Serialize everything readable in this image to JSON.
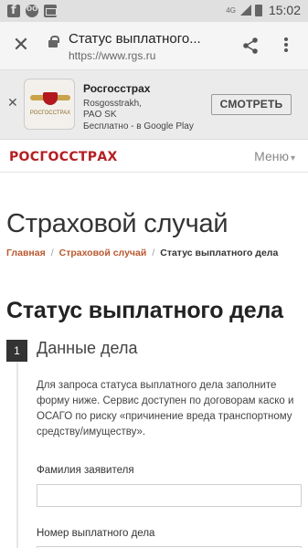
{
  "statusbar": {
    "network": "4G",
    "time": "15:02"
  },
  "browser": {
    "title": "Статус выплатного...",
    "url": "https://www.rgs.ru"
  },
  "app_banner": {
    "name": "Росгосстрах",
    "developer_line1": "Rosgosstrakh,",
    "developer_line2": "PAO SK",
    "price_line": "Бесплатно - в Google Play",
    "button_label": "СМОТРЕТЬ",
    "icon_text": "РОСГОССТРАХ"
  },
  "site": {
    "logo": "РОСГОССТРАХ",
    "menu_label": "Меню"
  },
  "page": {
    "heading": "Страховой случай",
    "breadcrumbs": [
      "Главная",
      "Страховой случай",
      "Статус выплатного дела"
    ],
    "section_title": "Статус выплатного дела",
    "step_number": "1",
    "step_title": "Данные дела",
    "description": "Для запроса статуса выплатного дела заполните форму ниже. Сервис доступен по договорам каско и ОСАГО по риску «причинение вреда транспортному средству/имуществу».",
    "fields": {
      "surname_label": "Фамилия заявителя",
      "surname_value": "",
      "case_label": "Номер выплатного дела",
      "case_value": ""
    }
  }
}
